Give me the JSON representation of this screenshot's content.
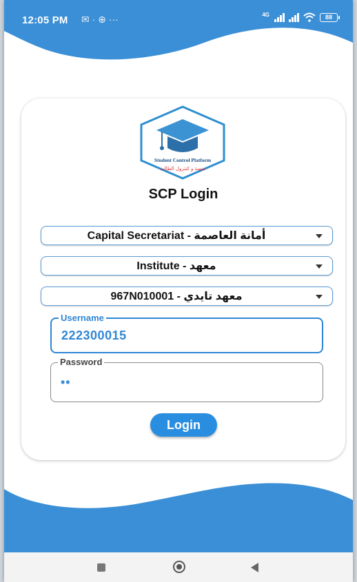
{
  "status_bar": {
    "time": "12:05 PM",
    "left_icons": "✉ · ⊕ ···",
    "network_type": "4G",
    "battery": "88"
  },
  "logo": {
    "name": "graduation-cap-logo",
    "text_en": "Student Control Platform",
    "text_ar": "منصة و كنترول الطالب"
  },
  "title": "SCP Login",
  "selects": [
    {
      "value": "Capital Secretariat - أمانة العاصمة"
    },
    {
      "value": "Institute - معهد"
    },
    {
      "value": "967N010001 - معهد تايدي"
    }
  ],
  "username": {
    "label": "Username",
    "value": "222300015"
  },
  "password": {
    "label": "Password",
    "value": "••"
  },
  "login_button": "Login",
  "colors": {
    "wave_blue": "#3b8fd6",
    "accent": "#2a8ee0",
    "logo_frame": "#2d8fd0",
    "logo_text_ar": "#d33"
  }
}
